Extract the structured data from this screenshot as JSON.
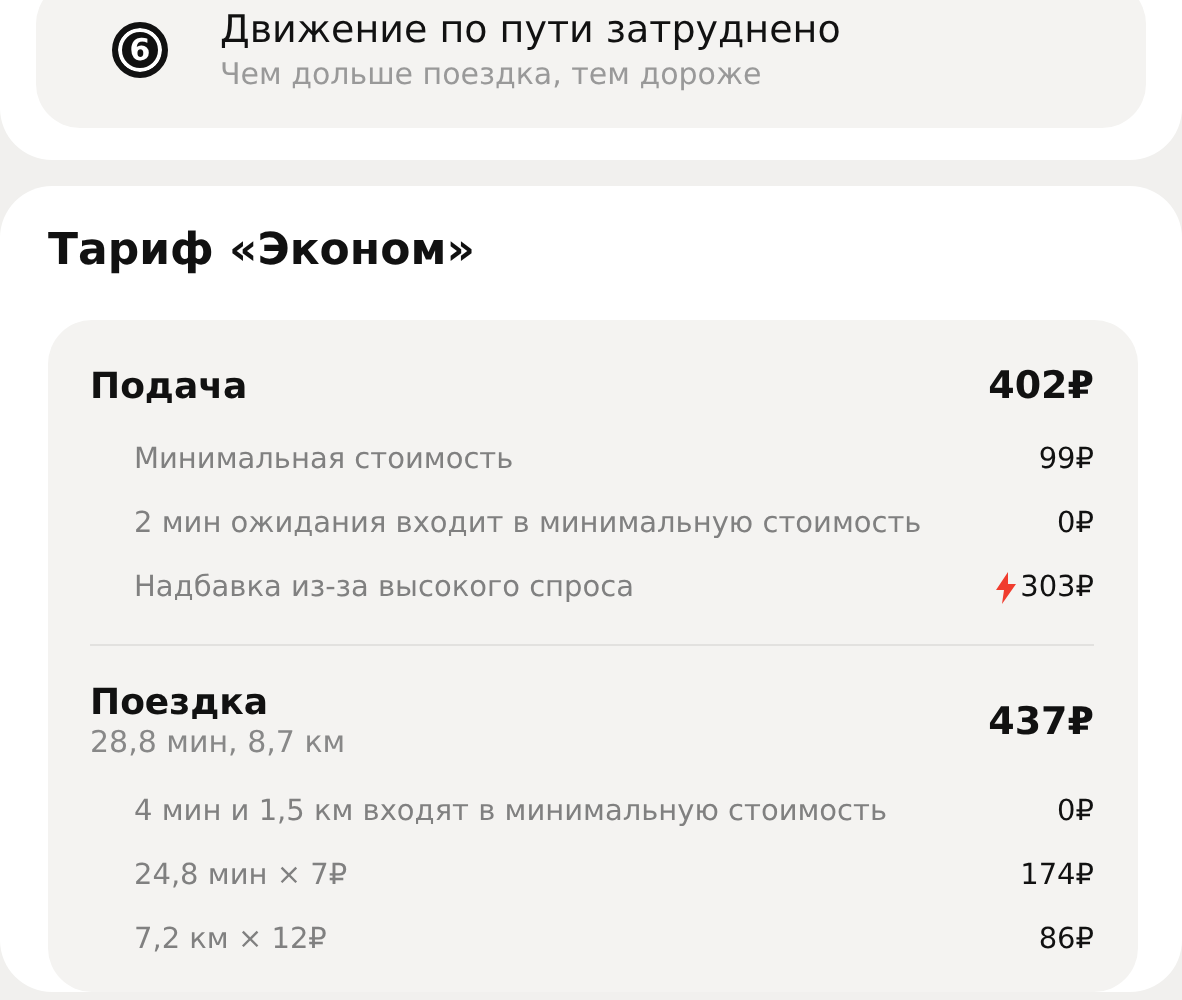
{
  "notice": {
    "icon_text": "6",
    "title": "Движение по пути затруднено",
    "subtitle": "Чем дольше поездка, тем дороже"
  },
  "tariff": {
    "title": "Тариф «Эконом»",
    "sections": [
      {
        "title": "Подача",
        "total": "402₽",
        "items": [
          {
            "kind": "plain",
            "label": "Минимальная стоимость",
            "price": "99₽"
          },
          {
            "kind": "plain",
            "label": "2 мин ожидания входит в минимальную стоимость",
            "price": "0₽"
          },
          {
            "kind": "surge",
            "label": "Надбавка из-за высокого спроса",
            "price": "303₽"
          }
        ]
      },
      {
        "title": "Поездка",
        "subtitle": "28,8 мин, 8,7 км",
        "total": "437₽",
        "items": [
          {
            "kind": "plain",
            "label": "4 мин и 1,5 км входят в минимальную стоимость",
            "price": "0₽"
          },
          {
            "kind": "plain",
            "label": "24,8 мин × 7₽",
            "price": "174₽"
          },
          {
            "kind": "plain",
            "label": "7,2 км × 12₽",
            "price": "86₽"
          }
        ]
      }
    ]
  }
}
